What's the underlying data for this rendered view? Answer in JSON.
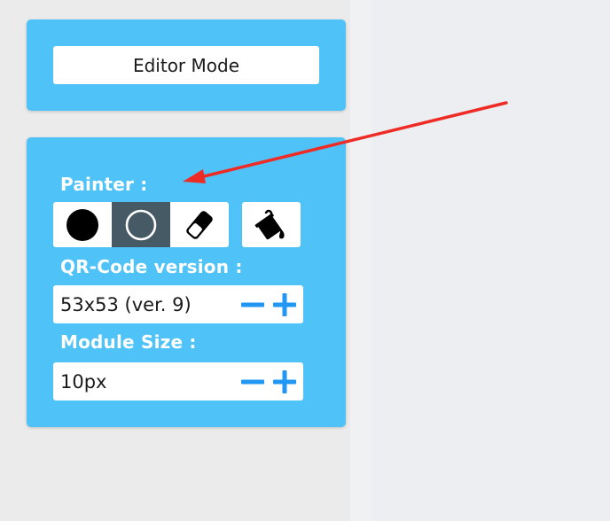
{
  "editor": {
    "mode_button_label": "Editor Mode"
  },
  "painter": {
    "label": "Painter :",
    "tools": [
      {
        "name": "filled-circle",
        "active": false
      },
      {
        "name": "outline-circle",
        "active": true
      },
      {
        "name": "eraser",
        "active": false
      }
    ],
    "fill_tool": "paint-bucket"
  },
  "qr_version": {
    "label": "QR-Code version :",
    "value": "53x53 (ver. 9)"
  },
  "module_size": {
    "label": "Module Size :",
    "value": "10px"
  },
  "colors": {
    "panel": "#4fc3f7",
    "active_tool": "#455a64",
    "stepper_icon": "#2196f3",
    "annotation_arrow": "#ee2b24"
  }
}
